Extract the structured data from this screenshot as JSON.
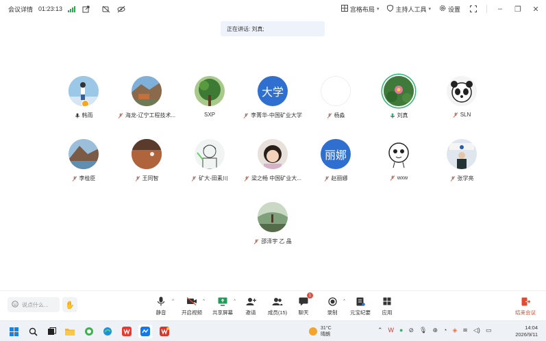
{
  "titlebar": {
    "meeting_details": "会议详情",
    "elapsed": "01:23:13",
    "layout_label": "宫格布局",
    "host_tools_label": "主持人工具",
    "settings_label": "设置"
  },
  "speaking_banner": "正在讲话: 刘真;",
  "participants": [
    {
      "name": "韩雨",
      "muted": false
    },
    {
      "name": "海龙-辽宁工程技术...",
      "muted": true
    },
    {
      "name": "SXP",
      "muted": null
    },
    {
      "name": "李菁华-中国矿业大学",
      "muted": true,
      "avatar_text": "大学"
    },
    {
      "name": "杨淼",
      "muted": true
    },
    {
      "name": "刘真",
      "muted": false
    },
    {
      "name": "SLN",
      "muted": true
    },
    {
      "name": "李桂臣",
      "muted": true
    },
    {
      "name": "王同智",
      "muted": true
    },
    {
      "name": "矿大-田素川",
      "muted": true
    },
    {
      "name": "梁之畅 中国矿业大...",
      "muted": true
    },
    {
      "name": "赵丽娜",
      "muted": true,
      "avatar_text": "丽娜"
    },
    {
      "name": "wxw",
      "muted": true
    },
    {
      "name": "张学亮",
      "muted": true
    },
    {
      "name": "邵泽宇 乙 晶",
      "muted": true
    }
  ],
  "toolbar": {
    "chat_placeholder": "说点什么...",
    "mute": "静音",
    "video": "开启视频",
    "share": "共享屏幕",
    "invite": "邀请",
    "members": "成员(15)",
    "chat": "聊天",
    "chat_badge": "1",
    "record": "录制",
    "notes": "元宝纪要",
    "apps": "应用",
    "end": "结束会议"
  },
  "taskbar": {
    "temperature": "31°C",
    "weather": "晴朗",
    "time": "14:04",
    "date": "2026/9/11"
  },
  "colors": {
    "accent": "#2f6fd0",
    "speaking_ring": "#2db46f",
    "end_red": "#e24b30",
    "signal_green": "#22b04b"
  }
}
